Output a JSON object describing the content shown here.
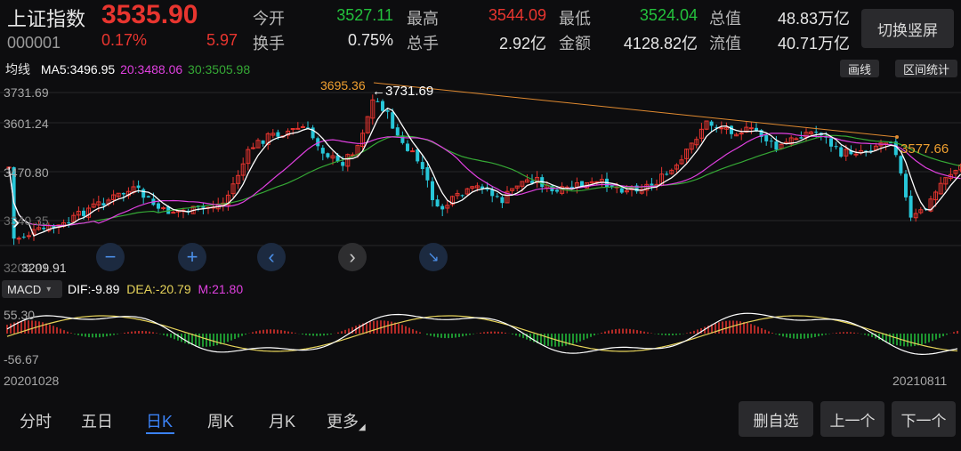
{
  "header": {
    "name": "上证指数",
    "code": "000001",
    "price": "3535.90",
    "change_pct": "0.17%",
    "change": "5.97",
    "stats": [
      {
        "label": "今开",
        "value": "3527.11"
      },
      {
        "label": "最高",
        "value": "3544.09"
      },
      {
        "label": "最低",
        "value": "3524.04"
      },
      {
        "label": "总值",
        "value": "48.83万亿"
      },
      {
        "label": "换手",
        "value": "0.75%"
      },
      {
        "label": "总手",
        "value": "2.92亿"
      },
      {
        "label": "金额",
        "value": "4128.82亿"
      },
      {
        "label": "流值",
        "value": "40.71万亿"
      }
    ],
    "switch_label": "切换竖屏"
  },
  "ma_bar": {
    "title": "均线",
    "ma5": "MA5:3496.95",
    "ma20": "20:3488.06",
    "ma30": "30:3505.98",
    "draw_label": "画线",
    "range_label": "区间统计"
  },
  "kline": {
    "y_labels": [
      "3731.69",
      "3601.24",
      "3470.80",
      "3340.35",
      "3209.91"
    ],
    "annot_high_left": "3695.36",
    "annot_high": "3731.69",
    "annot_right": "3577.66",
    "annot_low": "3209.91"
  },
  "macd": {
    "selector": "MACD",
    "dif": "DIF:-9.89",
    "dea": "DEA:-20.79",
    "m": "M:21.80",
    "y_top": "55.30",
    "y_bottom": "-56.67"
  },
  "dates": {
    "start": "20201028",
    "end": "20210811"
  },
  "tabs": [
    "分时",
    "五日",
    "日K",
    "周K",
    "月K",
    "更多"
  ],
  "active_tab": "日K",
  "bottom_buttons": [
    "删自选",
    "上一个",
    "下一个"
  ],
  "colors": {
    "up": "#e8352f",
    "down": "#23c13c",
    "ma5": "#ffffff",
    "ma20": "#e040e0",
    "ma30": "#35a835",
    "accent": "#3b82f6",
    "annot": "#f0a030"
  }
}
